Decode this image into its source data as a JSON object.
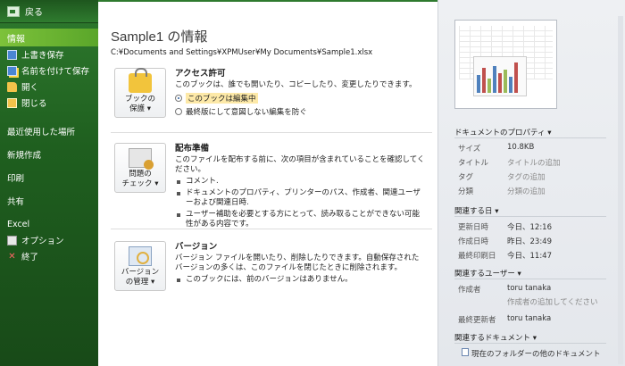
{
  "nav": {
    "back": "戻る",
    "items": [
      {
        "label": "情報",
        "icon": "none"
      },
      {
        "label": "上書き保存",
        "icon": "save-icon"
      },
      {
        "label": "名前を付けて保存",
        "icon": "save-as-icon"
      },
      {
        "label": "開く",
        "icon": "open-folder-icon"
      },
      {
        "label": "閉じる",
        "icon": "close-folder-icon"
      }
    ],
    "recent": "最近使用した場所",
    "new": "新規作成",
    "print": "印刷",
    "share": "共有",
    "excel": "Excel",
    "options": "オプション",
    "exit": "終了"
  },
  "main": {
    "title": "Sample1 の情報",
    "path": "C:¥Documents and Settings¥XPMUser¥My Documents¥Sample1.xlsx",
    "protect": {
      "button_line1": "ブックの",
      "button_line2": "保護 ▾",
      "heading": "アクセス許可",
      "desc": "このブックは、誰でも開いたり、コピーしたり、変更したりできます。",
      "radio1": "このブックは編集中",
      "radio2": "最終版にして意図しない編集を防ぐ"
    },
    "check": {
      "button_line1": "問題の",
      "button_line2": "チェック ▾",
      "heading": "配布準備",
      "desc": "このファイルを配布する前に、次の項目が含まれていることを確認してください。",
      "bullets": [
        "コメント.",
        "ドキュメントのプロパティ、プリンターのパス、作成者、関連ユーザーおよび関連日時.",
        "ユーザー補助を必要とする方にとって、読み取ることができない可能性がある内容です。"
      ]
    },
    "versions": {
      "button_line1": "バージョン",
      "button_line2": "の管理 ▾",
      "heading": "バージョン",
      "desc": "バージョン ファイルを開いたり、削除したりできます。自動保存されたバージョンの多くは、このファイルを閉じたときに削除されます。",
      "bullet": "このブックには、前のバージョンはありません。"
    }
  },
  "props": {
    "doc_props_head": "ドキュメントのプロパティ ▾",
    "size_k": "サイズ",
    "size_v": "10.8KB",
    "title_k": "タイトル",
    "title_v": "タイトルの追加",
    "tag_k": "タグ",
    "tag_v": "タグの追加",
    "cat_k": "分類",
    "cat_v": "分類の追加",
    "dates_head": "関連する日 ▾",
    "updated_k": "更新日時",
    "updated_v": "今日、12:16",
    "created_k": "作成日時",
    "created_v": "昨日、23:49",
    "printed_k": "最終印刷日",
    "printed_v": "今日、11:47",
    "users_head": "関連するユーザー ▾",
    "author_k": "作成者",
    "author_v": "toru tanaka",
    "author_add": "作成者の追加してください",
    "lastmod_k": "最終更新者",
    "lastmod_v": "toru tanaka",
    "docs_head": "関連するドキュメント ▾",
    "docs_link": "現在のフォルダーの他のドキュメント"
  },
  "colors": {
    "nav_bg": "#2e7a2e",
    "nav_active": "#7dc23a",
    "accent": "#2e7a2e"
  }
}
